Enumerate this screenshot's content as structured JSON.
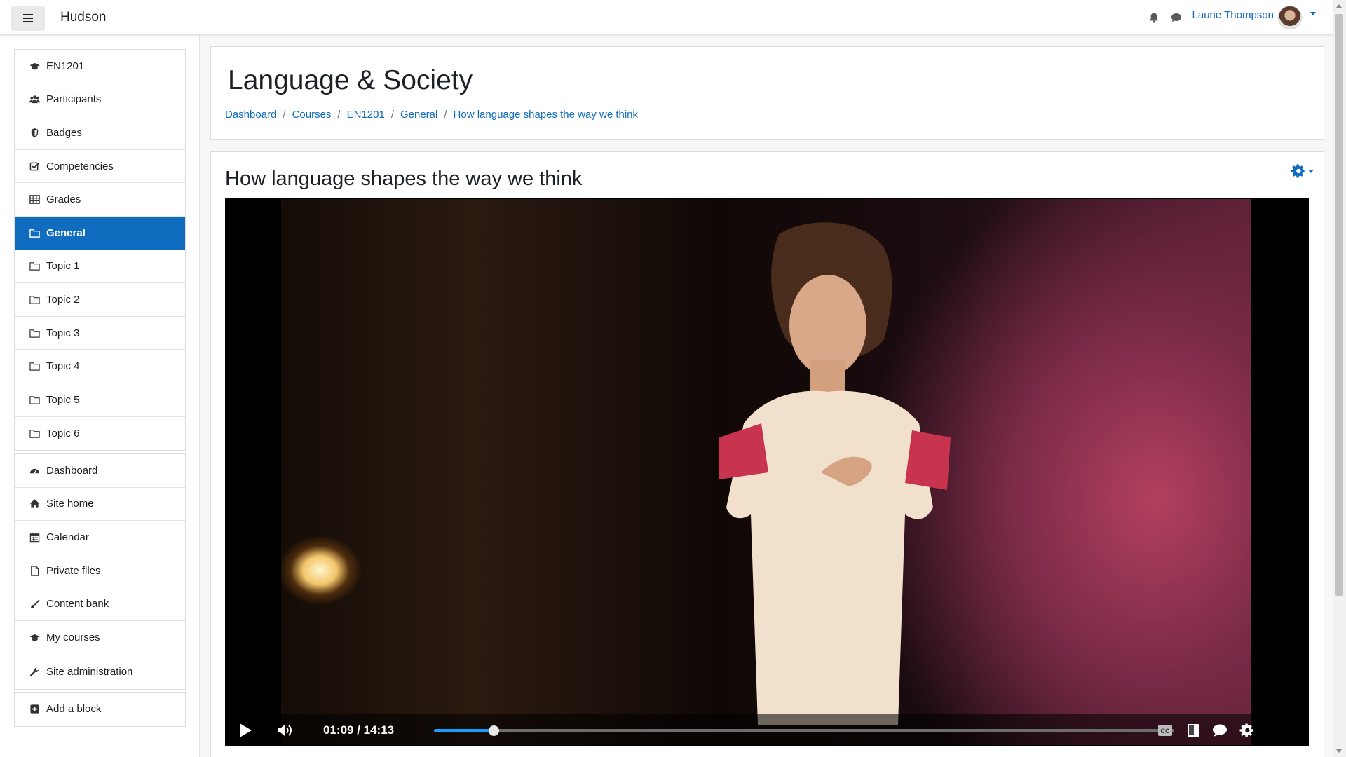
{
  "header": {
    "site_name": "Hudson",
    "user_name": "Laurie Thompson"
  },
  "sidebar": {
    "course_items": [
      {
        "label": "EN1201",
        "icon": "graduation-cap-icon"
      },
      {
        "label": "Participants",
        "icon": "users-icon"
      },
      {
        "label": "Badges",
        "icon": "shield-icon"
      },
      {
        "label": "Competencies",
        "icon": "check-square-icon"
      },
      {
        "label": "Grades",
        "icon": "table-icon"
      },
      {
        "label": "General",
        "icon": "folder-icon",
        "active": true
      },
      {
        "label": "Topic 1",
        "icon": "folder-icon"
      },
      {
        "label": "Topic 2",
        "icon": "folder-icon"
      },
      {
        "label": "Topic 3",
        "icon": "folder-icon"
      },
      {
        "label": "Topic 4",
        "icon": "folder-icon"
      },
      {
        "label": "Topic 5",
        "icon": "folder-icon"
      },
      {
        "label": "Topic 6",
        "icon": "folder-icon"
      }
    ],
    "site_items": [
      {
        "label": "Dashboard",
        "icon": "tachometer-icon"
      },
      {
        "label": "Site home",
        "icon": "home-icon"
      },
      {
        "label": "Calendar",
        "icon": "calendar-icon"
      },
      {
        "label": "Private files",
        "icon": "file-icon"
      },
      {
        "label": "Content bank",
        "icon": "paint-brush-icon"
      },
      {
        "label": "My courses",
        "icon": "graduation-cap-icon"
      }
    ],
    "admin_item": {
      "label": "Site administration",
      "icon": "wrench-icon"
    },
    "add_block": {
      "label": "Add a block",
      "icon": "plus-square-icon"
    }
  },
  "page": {
    "title": "Language & Society",
    "breadcrumb": [
      "Dashboard",
      "Courses",
      "EN1201",
      "General",
      "How language shapes the way we think"
    ],
    "breadcrumb_separator": "/"
  },
  "activity": {
    "title": "How language shapes the way we think"
  },
  "video": {
    "time_display": "01:09 / 14:13",
    "progress_fraction": 0.0809,
    "accent_color": "#1a9cff"
  },
  "colors": {
    "brand": "#0f6cbf",
    "active_nav_bg": "#0f6cbf"
  }
}
